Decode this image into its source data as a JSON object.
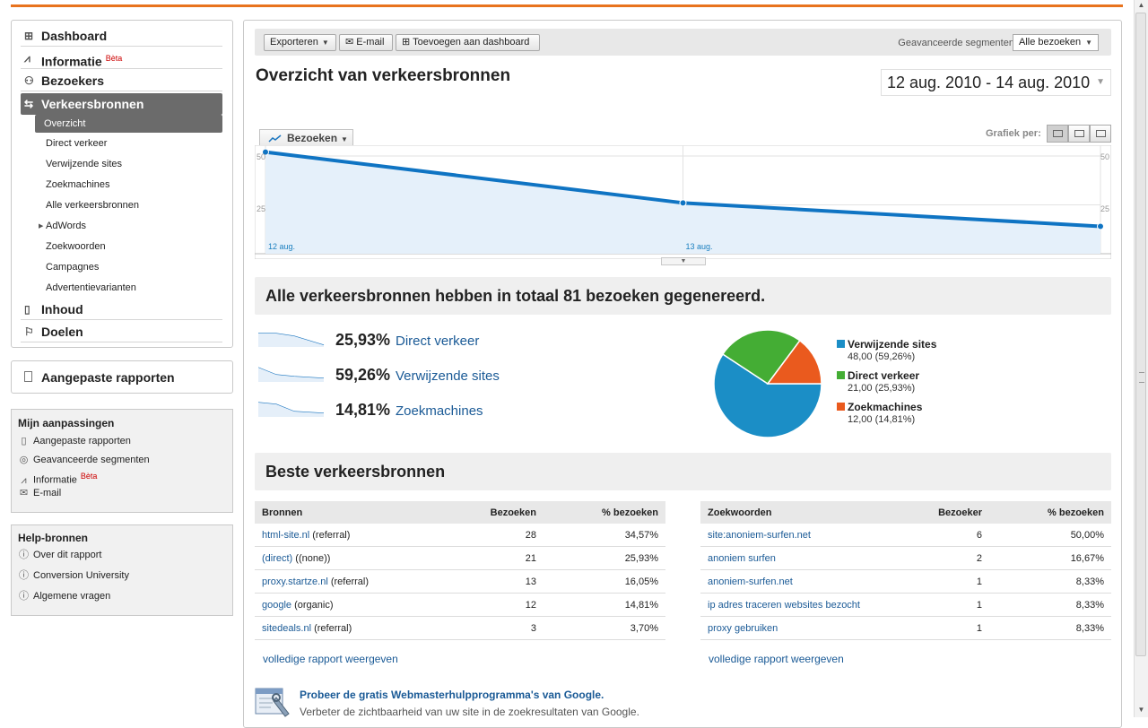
{
  "nav": {
    "main": [
      {
        "label": "Dashboard"
      },
      {
        "label": "Informatie",
        "badge": "Bèta"
      },
      {
        "label": "Bezoekers"
      },
      {
        "label": "Verkeersbronnen"
      },
      {
        "label": "Inhoud"
      },
      {
        "label": "Doelen"
      }
    ],
    "sub": [
      "Overzicht",
      "Direct verkeer",
      "Verwijzende sites",
      "Zoekmachines",
      "Alle verkeersbronnen",
      "AdWords",
      "Zoekwoorden",
      "Campagnes",
      "Advertentievarianten"
    ]
  },
  "custom_reports": "Aangepaste rapporten",
  "my_custom": {
    "title": "Mijn aanpassingen",
    "items": [
      "Aangepaste rapporten",
      "Geavanceerde segmenten",
      "Informatie",
      "E-mail"
    ],
    "badge": "Bèta"
  },
  "help": {
    "title": "Help-bronnen",
    "items": [
      "Over dit rapport",
      "Conversion University",
      "Algemene vragen"
    ]
  },
  "toolbar": {
    "export": "Exporteren",
    "email": "E-mail",
    "add_dashboard": "Toevoegen aan dashboard",
    "segments_label": "Geavanceerde segmenten:",
    "segments_value": "Alle bezoeken"
  },
  "page_title": "Overzicht van verkeersbronnen",
  "date_range": "12 aug. 2010 - 14 aug. 2010",
  "graph": {
    "metric": "Bezoeken",
    "per_label": "Grafiek per:"
  },
  "chart_data": {
    "type": "line",
    "series": [
      {
        "name": "Bezoeken",
        "values": [
          52,
          26,
          14
        ]
      }
    ],
    "x_labels": [
      "12 aug.",
      "13 aug.",
      ""
    ],
    "y_ticks_left": [
      "50",
      "25"
    ],
    "y_ticks_right": [
      "50",
      "25"
    ],
    "ylim": [
      0,
      50
    ]
  },
  "summary_title": "Alle verkeersbronnen hebben in totaal 81 bezoeken gegenereerd.",
  "sources": [
    {
      "pct": "25,93%",
      "name": "Direct verkeer"
    },
    {
      "pct": "59,26%",
      "name": "Verwijzende sites"
    },
    {
      "pct": "14,81%",
      "name": "Zoekmachines"
    }
  ],
  "pie_data": {
    "type": "pie",
    "slices": [
      {
        "name": "Verwijzende sites",
        "value": 48,
        "label": "48,00 (59,26%)",
        "color": "#1b8ec6"
      },
      {
        "name": "Direct verkeer",
        "value": 21,
        "label": "21,00 (25,93%)",
        "color": "#44ad34"
      },
      {
        "name": "Zoekmachines",
        "value": 12,
        "label": "12,00 (14,81%)",
        "color": "#ea5a1e"
      }
    ]
  },
  "best_title": "Beste verkeersbronnen",
  "sources_table": {
    "headers": [
      "Bronnen",
      "Bezoeken",
      "% bezoeken"
    ],
    "rows": [
      {
        "link": "html-site.nl",
        "suffix": " (referral)",
        "visits": "28",
        "pct": "34,57%"
      },
      {
        "link": "(direct)",
        "suffix": " ((none))",
        "visits": "21",
        "pct": "25,93%"
      },
      {
        "link": "proxy.startze.nl",
        "suffix": " (referral)",
        "visits": "13",
        "pct": "16,05%"
      },
      {
        "link": "google",
        "suffix": " (organic)",
        "visits": "12",
        "pct": "14,81%"
      },
      {
        "link": "sitedeals.nl",
        "suffix": " (referral)",
        "visits": "3",
        "pct": "3,70%"
      }
    ],
    "full_link": "volledige rapport weergeven"
  },
  "keywords_table": {
    "headers": [
      "Zoekwoorden",
      "Bezoeker",
      "% bezoeken"
    ],
    "rows": [
      {
        "link": "site:anoniem-surfen.net",
        "visits": "6",
        "pct": "50,00%"
      },
      {
        "link": "anoniem surfen",
        "visits": "2",
        "pct": "16,67%"
      },
      {
        "link": "anoniem-surfen.net",
        "visits": "1",
        "pct": "8,33%"
      },
      {
        "link": "ip adres traceren websites bezocht",
        "visits": "1",
        "pct": "8,33%"
      },
      {
        "link": "proxy gebruiken",
        "visits": "1",
        "pct": "8,33%"
      }
    ],
    "full_link": "volledige rapport weergeven"
  },
  "promo": {
    "title": "Probeer de gratis Webmasterhulpprogramma's van Google.",
    "text": "Verbeter de zichtbaarheid van uw site in de zoekresultaten van Google."
  }
}
